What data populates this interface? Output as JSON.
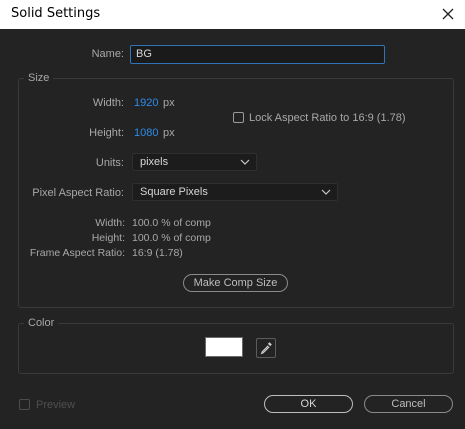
{
  "window": {
    "title": "Solid Settings"
  },
  "name_field": {
    "label": "Name:",
    "value": "BG"
  },
  "size": {
    "group_label": "Size",
    "width_label": "Width:",
    "width_value": "1920",
    "width_unit": "px",
    "height_label": "Height:",
    "height_value": "1080",
    "height_unit": "px",
    "lock_label": "Lock Aspect Ratio to 16:9 (1.78)",
    "units_label": "Units:",
    "units_value": "pixels",
    "par_label": "Pixel Aspect Ratio:",
    "par_value": "Square Pixels",
    "info": {
      "width_label": "Width:",
      "width_value": "100.0 % of comp",
      "height_label": "Height:",
      "height_value": "100.0 % of comp",
      "far_label": "Frame Aspect Ratio:",
      "far_value": "16:9 (1.78)"
    },
    "make_comp_size": "Make Comp Size"
  },
  "color": {
    "group_label": "Color",
    "swatch": "#ffffff"
  },
  "footer": {
    "preview_label": "Preview",
    "ok_label": "OK",
    "cancel_label": "Cancel"
  }
}
